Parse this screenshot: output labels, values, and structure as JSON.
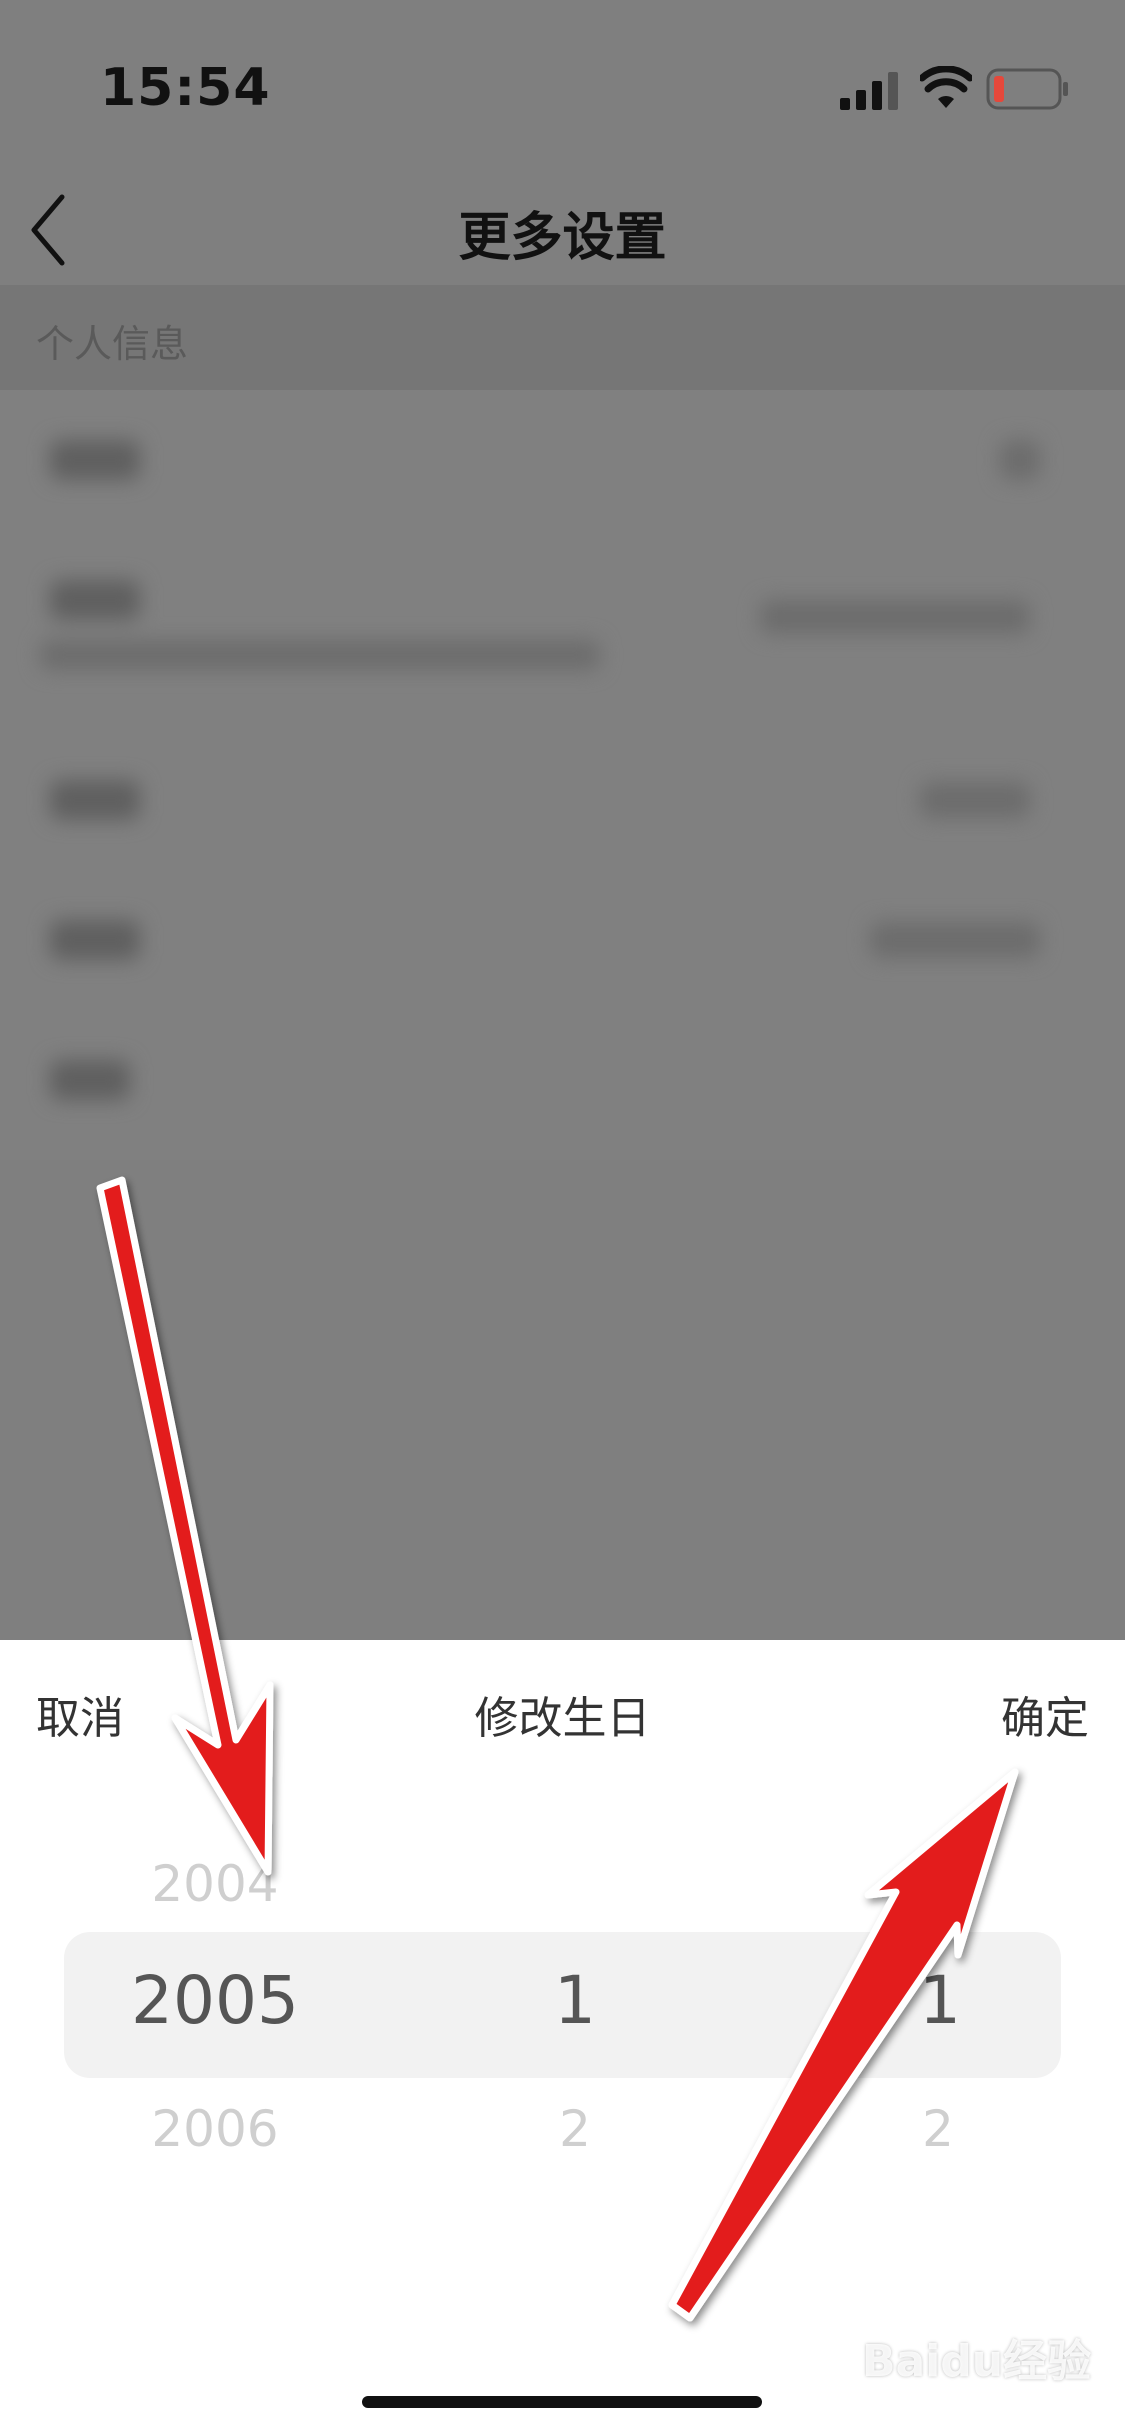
{
  "status_bar": {
    "time": "15:54",
    "icons": [
      "cellular-signal-icon",
      "wifi-icon",
      "battery-low-icon"
    ],
    "battery_color": "#e5483b"
  },
  "nav": {
    "title": "更多设置",
    "back_icon": "chevron-left-icon"
  },
  "section": {
    "title": "个人信息"
  },
  "sheet": {
    "cancel_label": "取消",
    "title": "修改生日",
    "confirm_label": "确定",
    "picker": {
      "year": {
        "prev": "2004",
        "selected": "2005",
        "next": "2006"
      },
      "month": {
        "selected": "1",
        "next": "2"
      },
      "day": {
        "selected": "1",
        "next": "2"
      }
    }
  },
  "watermark": {
    "text": "Baidu经验"
  },
  "colors": {
    "overlay": "#7f7f7f",
    "sheet_bg": "#ffffff",
    "picker_highlight": "#f2f2f2",
    "annotation_arrow": "#e31b1b"
  }
}
